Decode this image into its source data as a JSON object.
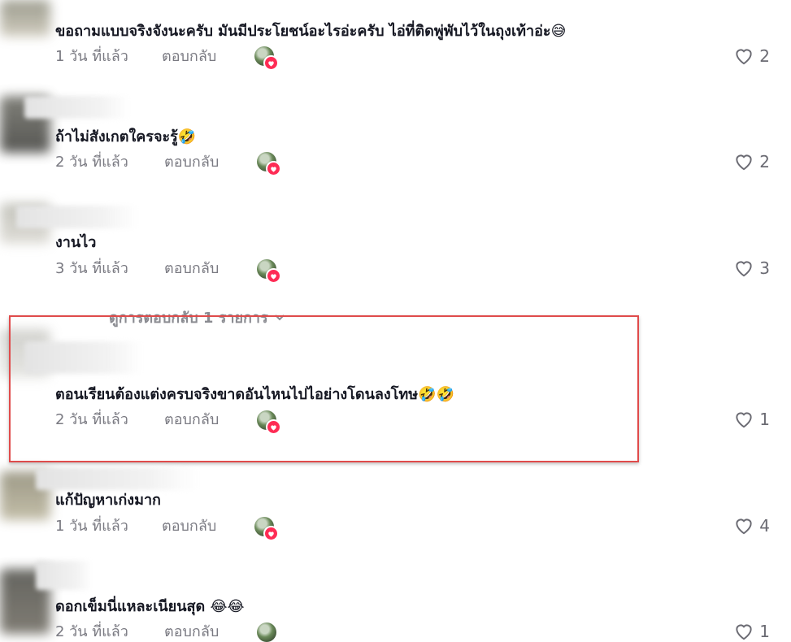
{
  "comments": [
    {
      "text": "ขอถามแบบจริงจังนะครับ มันมีประโยชน์อะไรอ่ะครับ ไอ่ที่ติดพู่พับไว้ในถุงเท้าอ่ะ😅",
      "time": "1 วัน ที่แล้ว",
      "reply": "ตอบกลับ",
      "likes": "2"
    },
    {
      "text": "ถ้าไม่สังเกตใครจะรู้🤣",
      "time": "2 วัน ที่แล้ว",
      "reply": "ตอบกลับ",
      "likes": "2"
    },
    {
      "text": "งานไว",
      "time": "3 วัน ที่แล้ว",
      "reply": "ตอบกลับ",
      "likes": "3"
    },
    {
      "text": "ตอนเรียนต้องแต่งครบจริงขาดอันไหนไปไอย่างโดนลงโทษ🤣🤣",
      "time": "2 วัน ที่แล้ว",
      "reply": "ตอบกลับ",
      "likes": "1"
    },
    {
      "text": "แก้ปัญหาเก่งมาก",
      "time": "1 วัน ที่แล้ว",
      "reply": "ตอบกลับ",
      "likes": "4"
    },
    {
      "text": "ดอกเข็มนี่แหละเนียนสุด 😂😂",
      "time": "2 วัน ที่แล้ว",
      "reply": "ตอบกลับ",
      "likes": "1"
    }
  ],
  "view_replies": "ดูการตอบกลับ 1 รายการ",
  "colors": {
    "accent": "#fe2c55",
    "highlight": "#e04b4b",
    "meta": "#7a7a82"
  },
  "icons": {
    "like": "heart-outline-icon",
    "expand": "chevron-down-icon",
    "creator_badge": "heart-badge-icon"
  }
}
